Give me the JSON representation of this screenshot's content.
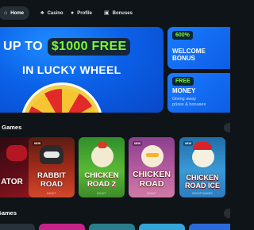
{
  "nav": {
    "tabs": [
      {
        "label": "Home",
        "icon": "home-icon",
        "active": true
      },
      {
        "label": "Casino",
        "icon": "cherry-icon",
        "active": false
      },
      {
        "label": "Profile",
        "icon": "user-icon",
        "active": false
      },
      {
        "label": "Bonuses",
        "icon": "gift-icon",
        "active": false
      }
    ]
  },
  "hero": {
    "line1_prefix": "UP TO",
    "line1_amount": "$1000 FREE",
    "line2": "IN LUCKY WHEEL",
    "accent": "#7dfc2c"
  },
  "promos": [
    {
      "badge": "600%",
      "title_line1": "WELCOME",
      "title_line2": "BONUS"
    },
    {
      "badge": "FREE",
      "title_line1": "MONEY",
      "sub_line1": "Giving away",
      "sub_line2": "prizes & bonuses"
    }
  ],
  "sections": {
    "quick_games_title": "k Games",
    "games_title": "Games"
  },
  "quick_games": [
    {
      "title_line1": "ATOR",
      "title_line2": "",
      "provider": "",
      "new": false
    },
    {
      "title_line1": "RABBIT",
      "title_line2": "ROAD",
      "provider": "INOUT",
      "new": true
    },
    {
      "title_line1": "CHICKEN",
      "title_line2": "ROAD 2",
      "provider": "INOUT",
      "new": false
    },
    {
      "title_line1": "CHICKEN",
      "title_line2": "ROAD",
      "provider": "INOUT",
      "new": true
    },
    {
      "title_line1": "CHICKEN",
      "title_line2": "ROAD ICE",
      "provider": "INOUTGAMES",
      "new": true
    }
  ]
}
